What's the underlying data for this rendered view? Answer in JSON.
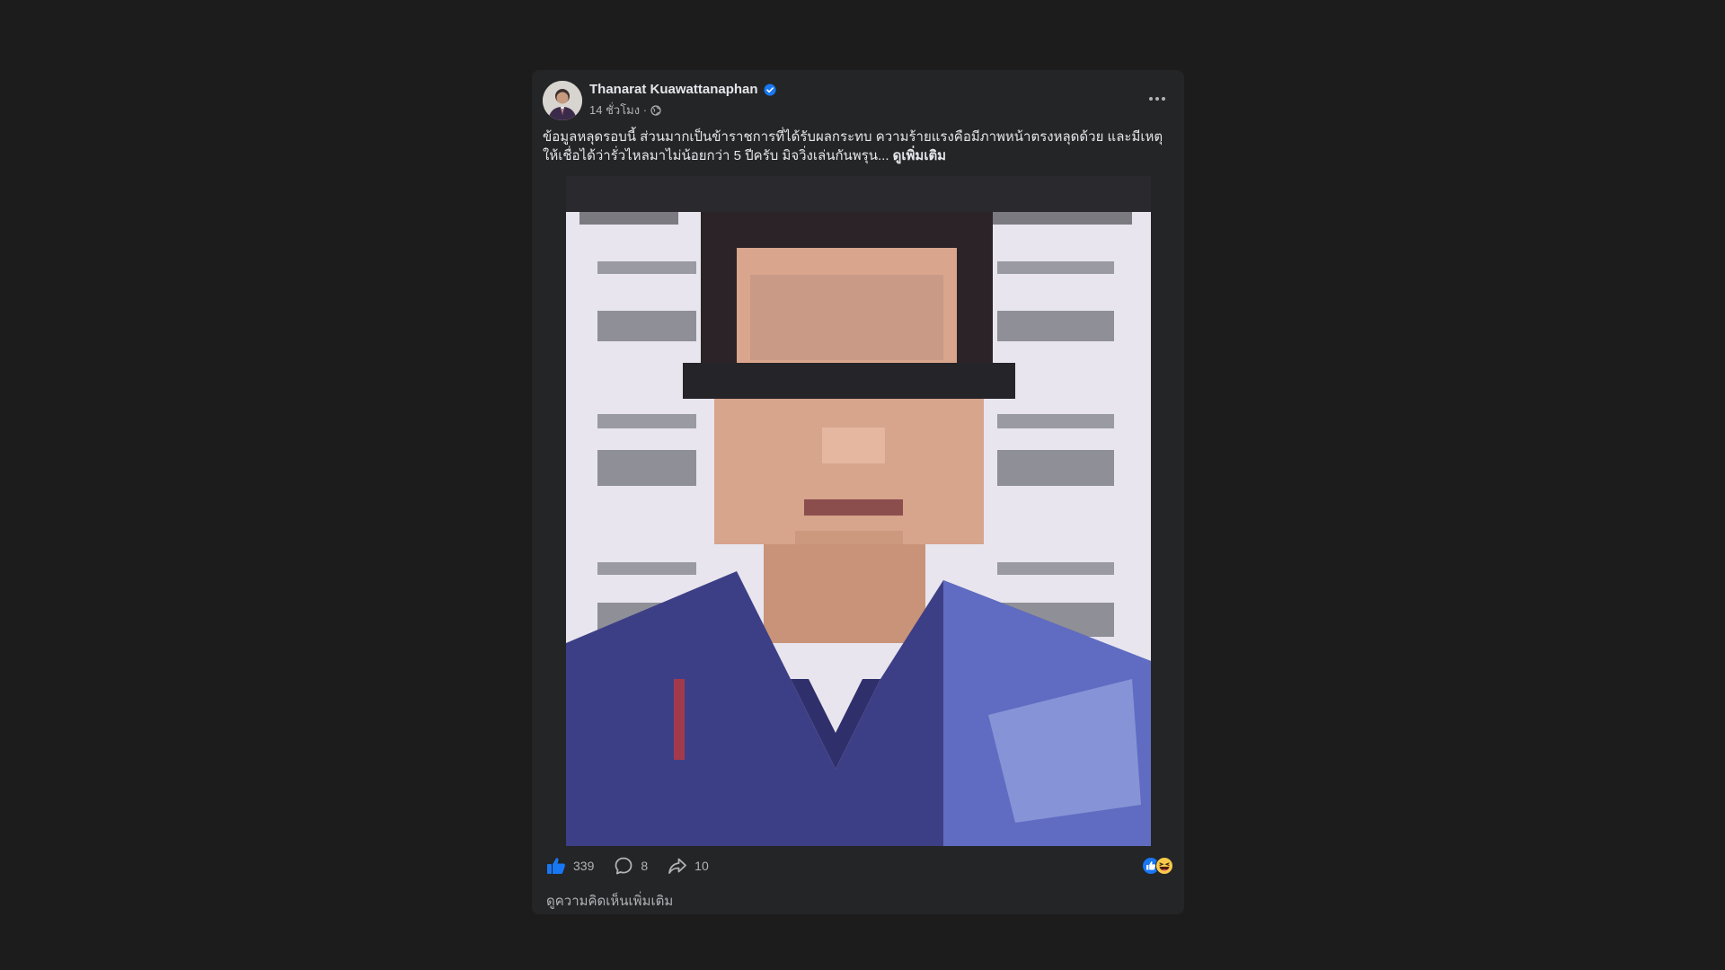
{
  "post": {
    "author": "Thanarat Kuawattanaphan",
    "timestamp": "14 ชั่วโมง ·",
    "text_line_1": "ข้อมูลหลุดรอบนี้ ส่วนมากเป็นข้าราชการที่ได้รับผลกระทบ ความร้ายแรงคือมีภาพหน้าตรงหลุดด้วย และมีเหตุ",
    "text_line_2": "ให้เชื่อได้ว่ารั่วไหลมาไม่น้อยกว่า 5 ปีครับ มิจวิ่งเล่นกันพรุน...",
    "see_more": "ดูเพิ่มเติม",
    "likes": "339",
    "comments": "8",
    "shares": "10",
    "view_more_comments": "ดูความคิดเห็นเพิ่มเติม"
  },
  "icons": {
    "avatar": "author-avatar",
    "verified": "verified-badge-icon",
    "audience": "globe-icon",
    "more": "more-options-icon",
    "like": "like-icon",
    "comment": "comment-icon",
    "share": "share-icon",
    "reactions": [
      "like-reaction-icon",
      "haha-reaction-icon"
    ]
  },
  "colors": {
    "background": "#1c1c1d",
    "card": "#242526",
    "primary_text": "#e4e6eb",
    "secondary_text": "#b0b3b8",
    "accent_blue": "#1877f2"
  }
}
